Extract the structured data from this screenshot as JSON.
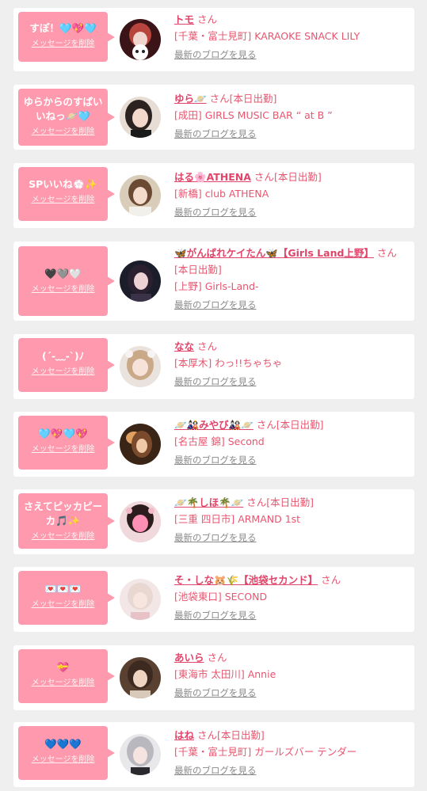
{
  "delete_label": "メッセージを削除",
  "blog_label": "最新のブログを見る",
  "san_label": "さん",
  "cards": [
    {
      "message": "すぽ！🩵💖🩵",
      "name": "トモ",
      "status": "",
      "shop": "[千葉・富士見町] KARAOKE SNACK LILY"
    },
    {
      "message": "ゆらからのすぱいいねっ🪐🩵",
      "name": "ゆら🪐",
      "status": "[本日出勤]",
      "shop": "[成田] GIRLS MUSIC BAR “ at B ”"
    },
    {
      "message": "SPいいね💮✨",
      "name": "はる🌸ATHENA",
      "status": "[本日出勤]",
      "shop": "[新橋] club ATHENA"
    },
    {
      "message": "🖤🩶🤍",
      "name": "🦋がんばれケイたん🦋【Girls Land上野】",
      "status": "[本日出勤]",
      "shop": "[上野] Girls-Land-"
    },
    {
      "message": "(´-﹏-`)ﾉ",
      "name": "なな",
      "status": "",
      "shop": "[本厚木] わっ!!ちゃちゃ"
    },
    {
      "message": "🩵💖🩵💖",
      "name": "🪐🎎みやび🎎🪐",
      "status": "[本日出勤]",
      "shop": "[名古屋 錦] Second"
    },
    {
      "message": "さえてピッカピーカ🎵✨",
      "name": "🪐🌴しほ🌴🪐",
      "status": "[本日出勤]",
      "shop": "[三重 四日市] ARMAND 1st"
    },
    {
      "message": "💌💌💌",
      "name": "そ・しな🐹🌾【池袋セカンド】",
      "status": "",
      "shop": "[池袋東口] SECOND"
    },
    {
      "message": "💝",
      "name": "あいら",
      "status": "",
      "shop": "[東海市 太田川] Annie"
    },
    {
      "message": "💙💙💙",
      "name": "はね",
      "status": "[本日出勤]",
      "shop": "[千葉・富士見町] ガールズバー テンダー"
    }
  ]
}
